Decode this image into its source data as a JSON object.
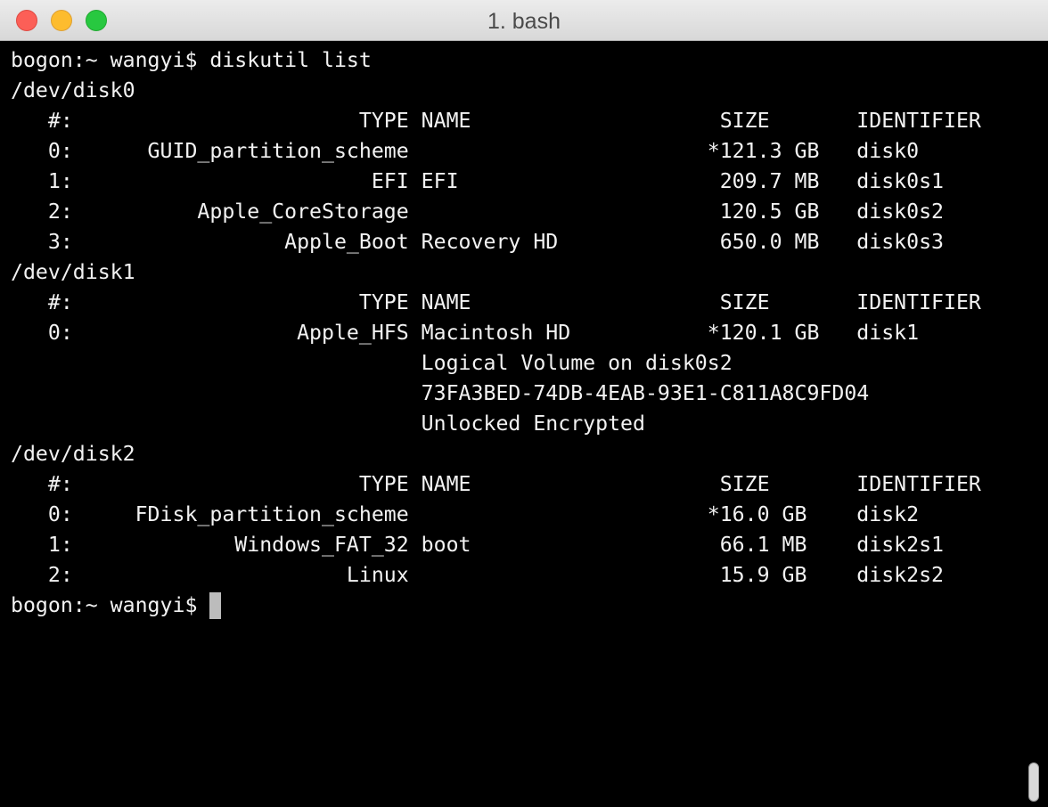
{
  "window": {
    "title": "1. bash"
  },
  "terminal": {
    "lines": [
      "bogon:~ wangyi$ diskutil list",
      "/dev/disk0",
      "   #:                       TYPE NAME                    SIZE       IDENTIFIER",
      "   0:      GUID_partition_scheme                        *121.3 GB   disk0",
      "   1:                        EFI EFI                     209.7 MB   disk0s1",
      "   2:          Apple_CoreStorage                         120.5 GB   disk0s2",
      "   3:                 Apple_Boot Recovery HD             650.0 MB   disk0s3",
      "/dev/disk1",
      "   #:                       TYPE NAME                    SIZE       IDENTIFIER",
      "   0:                  Apple_HFS Macintosh HD           *120.1 GB   disk1",
      "                                 Logical Volume on disk0s2",
      "                                 73FA3BED-74DB-4EAB-93E1-C811A8C9FD04",
      "                                 Unlocked Encrypted",
      "/dev/disk2",
      "   #:                       TYPE NAME                    SIZE       IDENTIFIER",
      "   0:     FDisk_partition_scheme                        *16.0 GB    disk2",
      "   1:             Windows_FAT_32 boot                    66.1 MB    disk2s1",
      "   2:                      Linux                         15.9 GB    disk2s2"
    ],
    "prompt": "bogon:~ wangyi$ "
  },
  "colors": {
    "background": "#000000",
    "foreground": "#f2f2f2",
    "cursor": "#bcbcbc"
  }
}
